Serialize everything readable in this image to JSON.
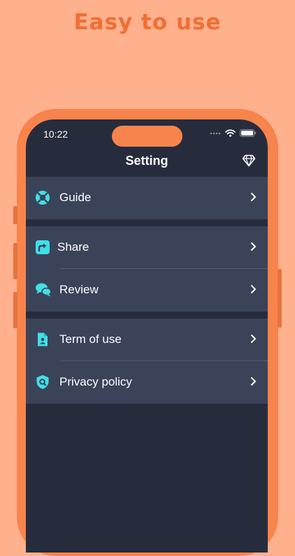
{
  "headline": "Easy to use",
  "status_bar": {
    "time": "10:22"
  },
  "nav": {
    "title": "Setting"
  },
  "colors": {
    "background": "#FFB08C",
    "accent_orange": "#F26E34",
    "phone_frame": "#F7844C",
    "screen_background": "#272C3D",
    "row_background": "#3B4359",
    "icon_cyan": "#3FE0E6",
    "text": "#FFFFFF"
  },
  "menu": {
    "guide": {
      "label": "Guide",
      "icon": "lifebuoy-icon"
    },
    "share": {
      "label": "Share",
      "icon": "share-icon"
    },
    "review": {
      "label": "Review",
      "icon": "chat-bubbles-icon"
    },
    "terms": {
      "label": "Term of use",
      "icon": "document-user-icon"
    },
    "privacy": {
      "label": "Privacy policy",
      "icon": "shield-search-icon"
    }
  }
}
